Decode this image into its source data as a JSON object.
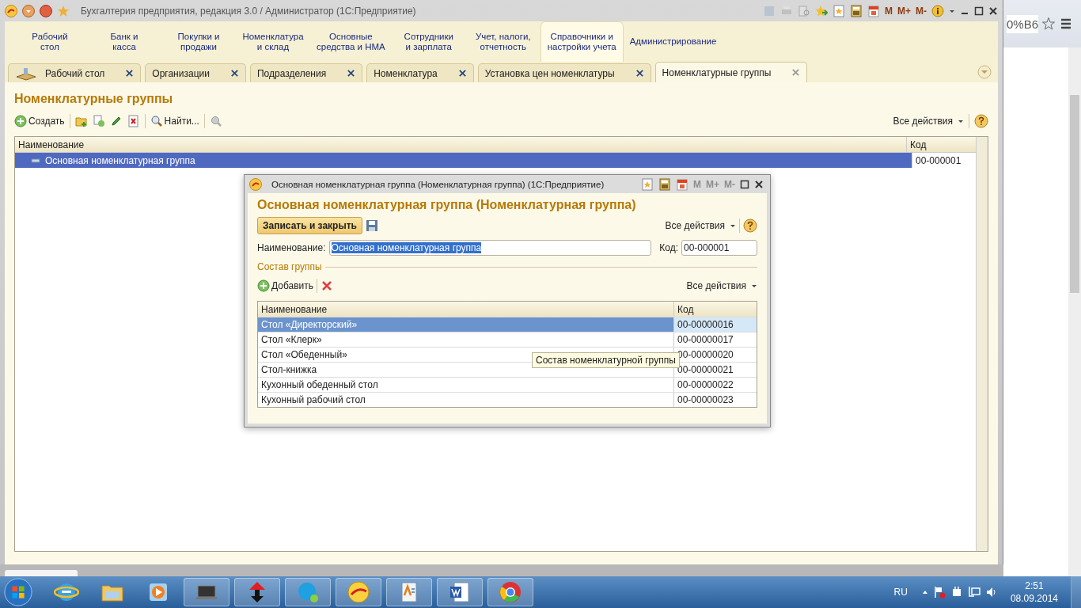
{
  "window": {
    "title": "Бухгалтерия предприятия, редакция 3.0 / Администратор  (1С:Предприятие)",
    "memory_buttons": [
      {
        "label": "M",
        "disabled": false
      },
      {
        "label": "M+",
        "disabled": false
      },
      {
        "label": "M-",
        "disabled": false
      }
    ]
  },
  "sections": [
    {
      "label": "Рабочий\nстол",
      "selected": false
    },
    {
      "label": "Банк и\nкасса",
      "selected": false
    },
    {
      "label": "Покупки и\nпродажи",
      "selected": false
    },
    {
      "label": "Номенклатура\nи склад",
      "selected": false
    },
    {
      "label": "Основные\nсредства и НМА",
      "selected": false
    },
    {
      "label": "Сотрудники\nи зарплата",
      "selected": false
    },
    {
      "label": "Учет, налоги,\nотчетность",
      "selected": false
    },
    {
      "label": "Справочники и\nнастройки учета",
      "selected": true
    },
    {
      "label": "Администрирование",
      "selected": false
    }
  ],
  "tabs": [
    {
      "label": "Рабочий стол",
      "kind": "home",
      "selected": false
    },
    {
      "label": "Организации",
      "kind": "form",
      "selected": false
    },
    {
      "label": "Подразделения",
      "kind": "form",
      "selected": false
    },
    {
      "label": "Номенклатура",
      "kind": "form",
      "selected": false
    },
    {
      "label": "Установка цен номенклатуры",
      "kind": "form",
      "selected": false
    },
    {
      "label": "Номенклатурные группы",
      "kind": "form",
      "selected": true
    }
  ],
  "page": {
    "title": "Номенклатурные группы",
    "create": "Создать",
    "find": "Найти...",
    "all_actions": "Все действия",
    "table": {
      "columns": [
        "Наименование",
        "Код"
      ],
      "rows": [
        {
          "name": "Основная номенклатурная группа",
          "code": "00-000001",
          "selected": true
        }
      ]
    }
  },
  "dialog": {
    "title": "Основная номенклатурная группа (Номенклатурная группа)  (1С:Предприятие)",
    "memory_buttons": [
      {
        "label": "M",
        "disabled": true
      },
      {
        "label": "M+",
        "disabled": true
      },
      {
        "label": "M-",
        "disabled": true
      }
    ],
    "heading": "Основная номенклатурная группа (Номенклатурная группа)",
    "save_close": "Записать и закрыть",
    "all_actions": "Все действия",
    "name_label": "Наименование:",
    "name_value": "Основная номенклатурная группа",
    "code_label": "Код:",
    "code_value": "00-000001",
    "group_label": "Состав группы",
    "add": "Добавить",
    "group_all_actions": "Все действия",
    "table": {
      "columns": [
        "Наименование",
        "Код"
      ],
      "rows": [
        {
          "name": "Стол «Директорский»",
          "code": "00-00000016",
          "selected": true
        },
        {
          "name": "Стол «Клерк»",
          "code": "00-00000017",
          "selected": false
        },
        {
          "name": "Стол «Обеденный»",
          "code": "00-00000020",
          "selected": false
        },
        {
          "name": "Стол-книжка",
          "code": "00-00000021",
          "selected": false
        },
        {
          "name": "Кухонный обеденный стол",
          "code": "00-00000022",
          "selected": false
        },
        {
          "name": "Кухонный рабочий стол",
          "code": "00-00000023",
          "selected": false
        }
      ]
    },
    "tooltip": "Состав номенклатурной группы"
  },
  "browser": {
    "address": "0%B6"
  },
  "taskbar": {
    "language": "RU",
    "time": "2:51",
    "date": "08.09.2014"
  }
}
